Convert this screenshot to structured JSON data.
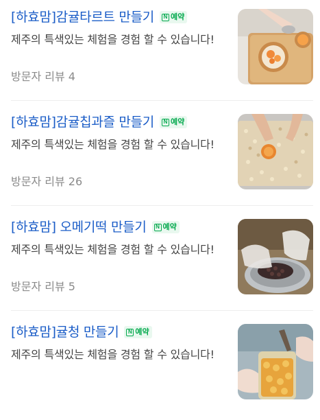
{
  "items": [
    {
      "title": "[하효맘]감귤타르트 만들기",
      "badge": "예약",
      "description": "제주의 특색있는 체험을 경험 할 수 있습니다!",
      "reviews": "방문자 리뷰 4",
      "thumb_icon": "tart-photo"
    },
    {
      "title": "[하효맘]감귤칩과즐 만들기",
      "badge": "예약",
      "description": "제주의 특색있는 체험을 경험 할 수 있습니다!",
      "reviews": "방문자 리뷰 26",
      "thumb_icon": "gwajul-photo"
    },
    {
      "title": "[하효맘] 오메기떡 만들기",
      "badge": "예약",
      "description": "제주의 특색있는 체험을 경험 할 수 있습니다!",
      "reviews": "방문자 리뷰 5",
      "thumb_icon": "omegi-photo"
    },
    {
      "title": "[하효맘]귤청 만들기",
      "badge": "예약",
      "description": "제주의 특색있는 체험을 경험 할 수 있습니다!",
      "reviews": "",
      "thumb_icon": "citrus-syrup-photo"
    }
  ],
  "colors": {
    "title": "#1a5cc7",
    "badge_green": "#03a94d",
    "badge_bg": "#e9f8ef"
  }
}
